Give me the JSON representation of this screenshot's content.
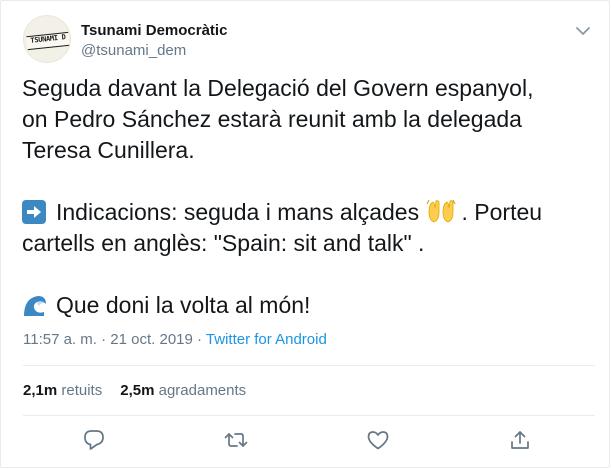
{
  "author": {
    "name": "Tsunami Democràtic",
    "handle": "@tsunami_dem",
    "avatar_text": "TSUNAMI D"
  },
  "tweet": {
    "line1": "Seguda davant la Delegació del Govern espanyol,",
    "line2": "on Pedro Sánchez estarà reunit amb la delegada",
    "line3": "Teresa Cunillera.",
    "indications_part1": "Indicacions: seguda i mans alçades",
    "indications_part2": ". Porteu",
    "indications_line2": "cartells en anglès: \"Spain: sit and talk\" .",
    "closing": "Que doni la volta al món!"
  },
  "meta": {
    "time": "11:57 a. m.",
    "separator1": " · ",
    "date": "21 oct. 2019",
    "separator2": " · ",
    "source": "Twitter for Android"
  },
  "stats": {
    "retweets_count": "2,1m",
    "retweets_label": "retuits",
    "likes_count": "2,5m",
    "likes_label": "agradaments"
  },
  "icons": {
    "caret": "chevron-down-icon",
    "reply": "reply-icon",
    "retweet": "retweet-icon",
    "like": "heart-icon",
    "share": "share-icon"
  },
  "colors": {
    "text": "#14171a",
    "secondary": "#657786",
    "link": "#1b95e0",
    "border": "#e6ecf0"
  }
}
